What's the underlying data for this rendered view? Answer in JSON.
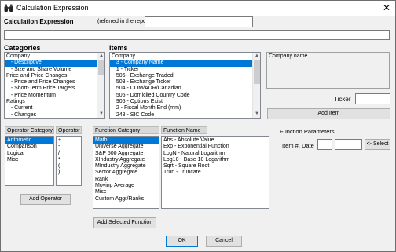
{
  "window": {
    "title": "Calculation Expression",
    "close_glyph": "✕"
  },
  "expression": {
    "label": "Calculation Expression",
    "note": "(referred in the report as)",
    "name_value": "",
    "formula_value": ""
  },
  "categories": {
    "heading": "Categories",
    "rows": [
      "Company",
      "   - Descriptive",
      "   - Size and Share Volume",
      "Price and Price Changes",
      "   - Price and Price Changes",
      "   - Short-Term Price Targets",
      "   - Price Momentum",
      "Ratings",
      "   - Current",
      "   - Changes"
    ],
    "selected_index": 1
  },
  "items": {
    "heading": "Items",
    "rows": [
      "Company",
      "   3 - Company Name",
      "   1 - Ticker",
      "   506 - Exchange Traded",
      "   503 - Exchange Ticker",
      "   504 - COM/ADR/Canadian",
      "   505 - Domiciled Country Code",
      "   905 - Options Exist",
      "   2 - Fiscal Month End (mm)",
      "   248 - SIC Code"
    ],
    "selected_index": 1
  },
  "description": {
    "text": "Company name."
  },
  "ticker": {
    "label": "Ticker",
    "value": ""
  },
  "add_item_label": "Add Item",
  "operator_category": {
    "header": "Operator Category",
    "rows": [
      "Arithmetic",
      "Comparison",
      "Logical",
      "Misc"
    ],
    "selected_index": 0
  },
  "operator": {
    "header": "Operator",
    "rows": [
      "+",
      "-",
      "/",
      "*",
      "(",
      ")"
    ]
  },
  "add_operator_label": "Add Operator",
  "function_category": {
    "header": "Function Category",
    "rows": [
      "Math",
      "Universe Aggregate",
      "S&P 500 Aggregate",
      "XIndustry Aggregate",
      "MIndustry Aggregate",
      "Sector Aggregate",
      "Rank",
      "Moving Average",
      "Misc",
      "Custom Aggr/Ranks"
    ],
    "selected_index": 0
  },
  "function_name": {
    "header": "Function Name",
    "rows": [
      "Abs - Absolute Value",
      "Exp - Exponential Function",
      "LogN - Natural Logarithm",
      "Log10 - Base 10 Logarithm",
      "Sqrt - Square Root",
      "Trun - Truncate"
    ]
  },
  "function_parameters": {
    "heading": "Function Parameters",
    "item_date_label": "Item #, Date",
    "item_value": "",
    "date_value": "",
    "select_label": "<- Select"
  },
  "add_function_label": "Add Selected Function",
  "ok_label": "OK",
  "cancel_label": "Cancel"
}
